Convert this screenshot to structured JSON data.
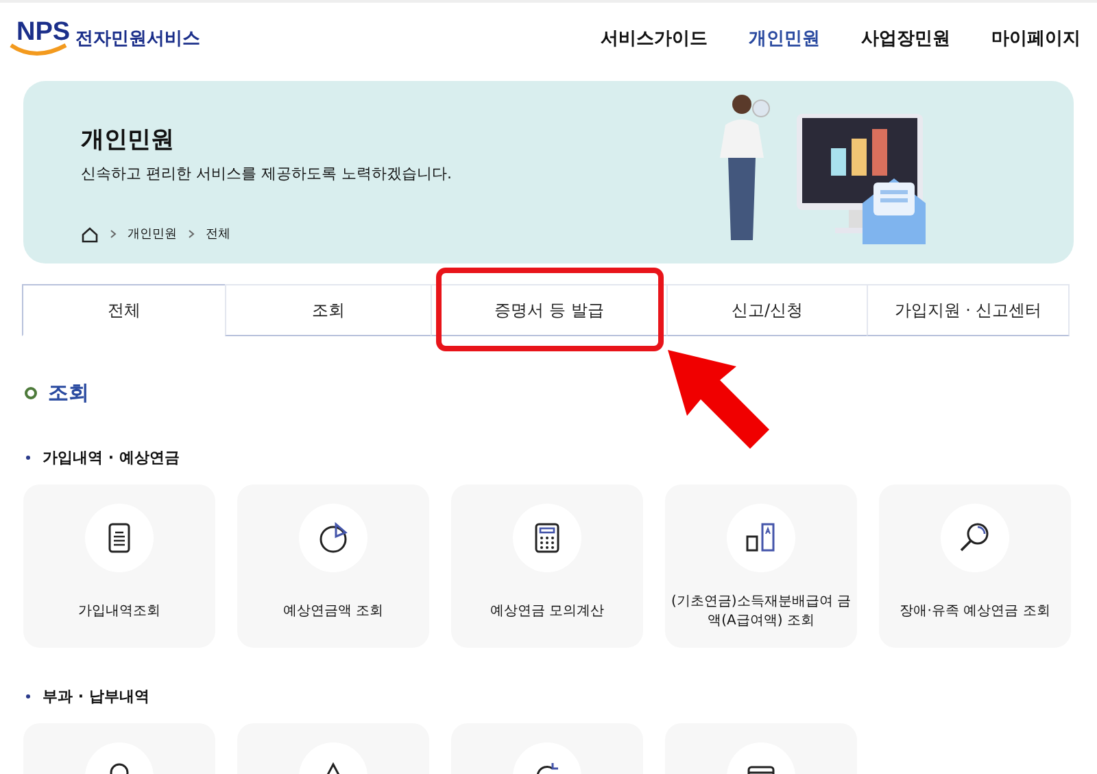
{
  "header": {
    "logo": "NPS",
    "service_name": "전자민원서비스",
    "nav": [
      {
        "label": "서비스가이드",
        "selected": false
      },
      {
        "label": "개인민원",
        "selected": true
      },
      {
        "label": "사업장민원",
        "selected": false
      },
      {
        "label": "마이페이지",
        "selected": false
      }
    ]
  },
  "banner": {
    "title": "개인민원",
    "subtitle": "신속하고 편리한 서비스를 제공하도록 노력하겠습니다.",
    "breadcrumb": [
      "개인민원",
      "전체"
    ]
  },
  "tabs": [
    {
      "label": "전체",
      "selected": true
    },
    {
      "label": "조회",
      "selected": false
    },
    {
      "label": "증명서 등 발급",
      "selected": false
    },
    {
      "label": "신고/신청",
      "selected": false
    },
    {
      "label": "가입지원 · 신고센터",
      "selected": false
    }
  ],
  "section_title": "조회",
  "groups": [
    {
      "title": "가입내역 · 예상연금",
      "cards": [
        {
          "kind": "document",
          "label": "가입내역조회"
        },
        {
          "kind": "pie",
          "label": "예상연금액 조회"
        },
        {
          "kind": "calculator",
          "label": "예상연금 모의계산"
        },
        {
          "kind": "bars",
          "label": "(기초연금)소득재분배급여 금액(A급여액) 조회"
        },
        {
          "kind": "magnifier",
          "label": "장애·유족 예상연금 조회"
        }
      ]
    },
    {
      "title": "부과 · 납부내역",
      "cards": [
        {
          "kind": "person"
        },
        {
          "kind": "triangle"
        },
        {
          "kind": "refresh"
        },
        {
          "kind": "card"
        }
      ]
    }
  ]
}
